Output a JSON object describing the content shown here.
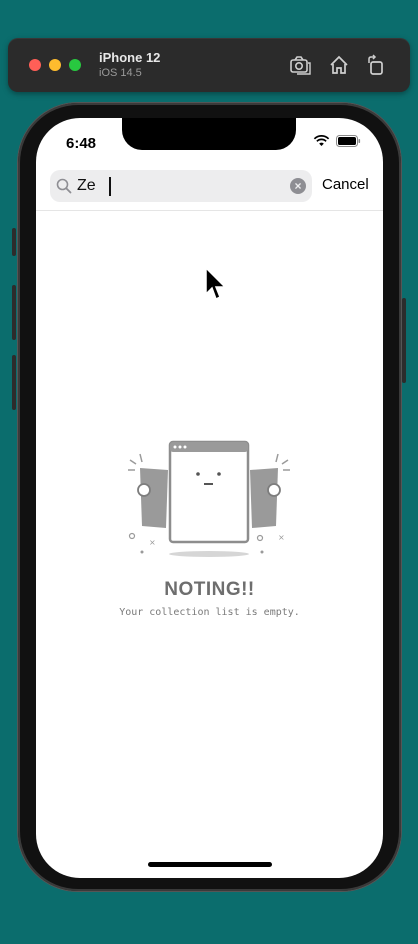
{
  "simulator": {
    "device_name": "iPhone 12",
    "os_version": "iOS 14.5",
    "toolbar_icons": [
      "screenshot-icon",
      "home-icon",
      "rotate-icon"
    ]
  },
  "status_bar": {
    "time": "6:48",
    "icons": [
      "wifi-icon",
      "battery-icon"
    ]
  },
  "search": {
    "value": "Ze",
    "cancel_label": "Cancel"
  },
  "empty_state": {
    "title": "NOTING!!",
    "subtitle": "Your collection list is empty."
  },
  "colors": {
    "background": "#0b6d6d",
    "illustration_gray": "#9a9a9a"
  }
}
